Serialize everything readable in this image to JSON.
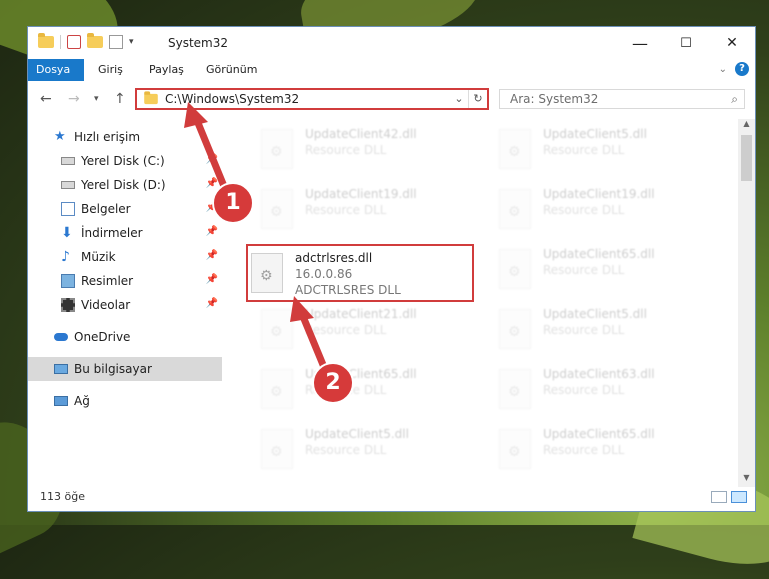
{
  "window": {
    "title": "System32",
    "controls": {
      "minimize": "—",
      "maximize": "☐",
      "close": "✕"
    }
  },
  "ribbon": {
    "tabs": [
      "Dosya",
      "Giriş",
      "Paylaş",
      "Görünüm"
    ],
    "help": "?"
  },
  "nav": {
    "address": "C:\\Windows\\System32",
    "search_placeholder": "Ara: System32"
  },
  "sidebar": {
    "items": [
      {
        "label": "Hızlı erişim",
        "icon": "star-icon"
      },
      {
        "label": "Yerel Disk (C:)",
        "icon": "drive-icon"
      },
      {
        "label": "Yerel Disk (D:)",
        "icon": "drive-icon"
      },
      {
        "label": "Belgeler",
        "icon": "documents-icon"
      },
      {
        "label": "İndirmeler",
        "icon": "download-icon"
      },
      {
        "label": "Müzik",
        "icon": "music-icon"
      },
      {
        "label": "Resimler",
        "icon": "pictures-icon"
      },
      {
        "label": "Videolar",
        "icon": "videos-icon"
      },
      {
        "label": "OneDrive",
        "icon": "cloud-icon"
      },
      {
        "label": "Bu bilgisayar",
        "icon": "computer-icon"
      },
      {
        "label": "Ağ",
        "icon": "network-icon"
      }
    ]
  },
  "files": {
    "left": [
      {
        "name": "UpdateClient42.dll",
        "desc": "Resource DLL"
      },
      {
        "name": "UpdateClient19.dll",
        "desc": "Resource DLL"
      },
      {
        "name": "adctrlsres.dll",
        "desc": "16.0.0.86",
        "desc2": "ADCTRLSRES DLL"
      },
      {
        "name": "UpdateClient21.dll",
        "desc": "Resource DLL"
      },
      {
        "name": "UpdateClient65.dll",
        "desc": "Resource DLL"
      },
      {
        "name": "UpdateClient5.dll",
        "desc": "Resource DLL"
      }
    ],
    "right": [
      {
        "name": "UpdateClient5.dll",
        "desc": "Resource DLL"
      },
      {
        "name": "UpdateClient19.dll",
        "desc": "Resource DLL"
      },
      {
        "name": "UpdateClient65.dll",
        "desc": "Resource DLL"
      },
      {
        "name": "UpdateClient5.dll",
        "desc": "Resource DLL"
      },
      {
        "name": "UpdateClient63.dll",
        "desc": "Resource DLL"
      },
      {
        "name": "UpdateClient65.dll",
        "desc": "Resource DLL"
      }
    ]
  },
  "status": {
    "count": "113 öğe"
  },
  "callouts": [
    "1",
    "2"
  ],
  "colors": {
    "accent": "#1979ca",
    "highlight": "#d13c3c"
  }
}
